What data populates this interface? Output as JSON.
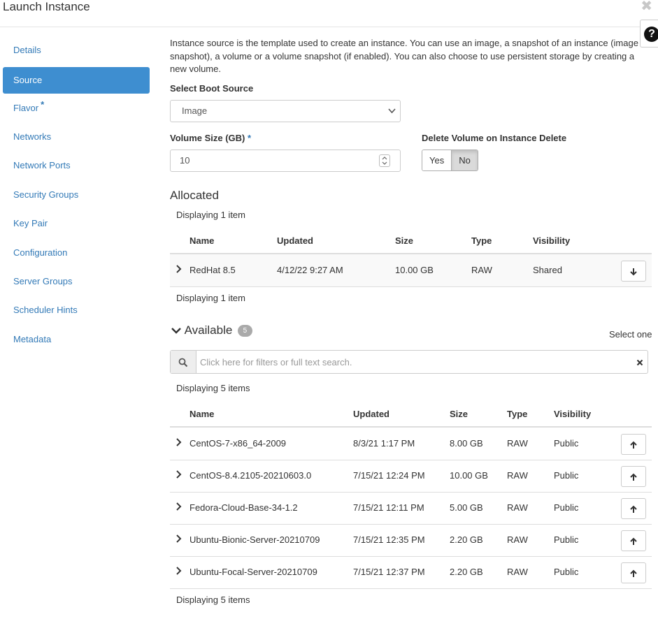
{
  "modal": {
    "title": "Launch Instance",
    "close_glyph": "✖",
    "help_glyph": "?"
  },
  "sidebar": {
    "items": [
      {
        "label": "Details",
        "required": false
      },
      {
        "label": "Source",
        "required": false
      },
      {
        "label": "Flavor",
        "required": true
      },
      {
        "label": "Networks",
        "required": false
      },
      {
        "label": "Network Ports",
        "required": false
      },
      {
        "label": "Security Groups",
        "required": false
      },
      {
        "label": "Key Pair",
        "required": false
      },
      {
        "label": "Configuration",
        "required": false
      },
      {
        "label": "Server Groups",
        "required": false
      },
      {
        "label": "Scheduler Hints",
        "required": false
      },
      {
        "label": "Metadata",
        "required": false
      }
    ],
    "active": "Source",
    "required_mark": "*"
  },
  "source": {
    "description": "Instance source is the template used to create an instance. You can use an image, a snapshot of an instance (image snapshot), a volume or a volume snapshot (if enabled). You can also choose to use persistent storage by creating a new volume.",
    "boot_source_label": "Select Boot Source",
    "boot_source_value": "Image",
    "volume_size_label": "Volume Size (GB)",
    "volume_size_required": "*",
    "volume_size_value": "10",
    "delete_volume_label": "Delete Volume on Instance Delete",
    "delete_volume_options": [
      "Yes",
      "No"
    ],
    "delete_volume_selected": "No"
  },
  "allocated": {
    "title": "Allocated",
    "count_text": "Displaying 1 item",
    "columns": [
      "Name",
      "Updated",
      "Size",
      "Type",
      "Visibility"
    ],
    "rows": [
      {
        "name": "RedHat 8.5",
        "updated": "4/12/22 9:27 AM",
        "size": "10.00 GB",
        "type": "RAW",
        "visibility": "Shared"
      }
    ]
  },
  "available": {
    "title": "Available",
    "badge": "5",
    "select_hint": "Select one",
    "search_placeholder": "Click here for filters or full text search.",
    "count_text": "Displaying 5 items",
    "columns": [
      "Name",
      "Updated",
      "Size",
      "Type",
      "Visibility"
    ],
    "rows": [
      {
        "name": "CentOS-7-x86_64-2009",
        "updated": "8/3/21 1:17 PM",
        "size": "8.00 GB",
        "type": "RAW",
        "visibility": "Public"
      },
      {
        "name": "CentOS-8.4.2105-20210603.0",
        "updated": "7/15/21 12:24 PM",
        "size": "10.00 GB",
        "type": "RAW",
        "visibility": "Public"
      },
      {
        "name": "Fedora-Cloud-Base-34-1.2",
        "updated": "7/15/21 12:11 PM",
        "size": "5.00 GB",
        "type": "RAW",
        "visibility": "Public"
      },
      {
        "name": "Ubuntu-Bionic-Server-20210709",
        "updated": "7/15/21 12:35 PM",
        "size": "2.20 GB",
        "type": "RAW",
        "visibility": "Public"
      },
      {
        "name": "Ubuntu-Focal-Server-20210709",
        "updated": "7/15/21 12:37 PM",
        "size": "2.20 GB",
        "type": "RAW",
        "visibility": "Public"
      }
    ]
  },
  "icons": {
    "search": "search-icon",
    "clear": "close-icon",
    "expand": "chevron-right-icon",
    "collapse": "chevron-down-icon",
    "allocate": "arrow-up-icon",
    "deallocate": "arrow-down-icon"
  },
  "colors": {
    "accent": "#3e8ed0",
    "link": "#337ab7",
    "badge": "#aaaaaa"
  }
}
